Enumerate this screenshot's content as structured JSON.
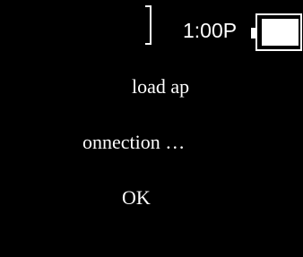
{
  "status_bar": {
    "time": "1:00P",
    "signal_icon": "signal-bracket-icon",
    "battery_icon": "battery-icon"
  },
  "message": {
    "line_1": "load ap",
    "line_2": "onnection …"
  },
  "dialog": {
    "ok_label": "OK"
  },
  "colors": {
    "background": "#000000",
    "foreground": "#ffffff"
  }
}
